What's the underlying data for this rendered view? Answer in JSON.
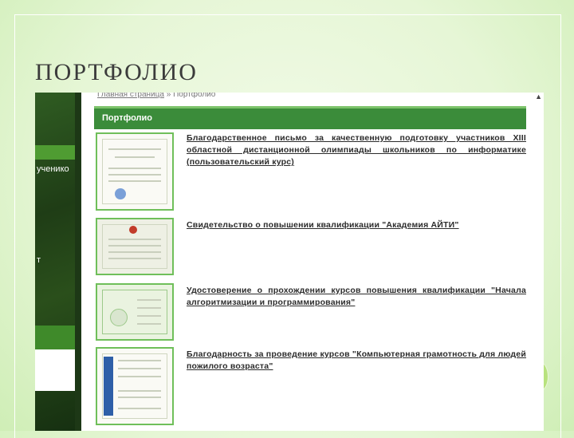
{
  "slide": {
    "title": "ПОРТФОЛИО"
  },
  "left_panel": {
    "text_1": "ученико",
    "text_2": "т"
  },
  "page": {
    "breadcrumb": {
      "home": "Главная страница",
      "separator": "»",
      "current": "Портфолио"
    },
    "header": "Портфолио",
    "items": [
      {
        "title": "Благодарственное письмо за качественную подготовку участников XIII областной дистанционной олимпиады школьников по информатике (пользовательский курс)"
      },
      {
        "title": "Свидетельство о повышении квалификации \"Академия АЙТИ\""
      },
      {
        "title": "Удостоверение о прохождении курсов повышения квалификации \"Начала алгоритмизации и программирования\""
      },
      {
        "title": "Благодарность за проведение курсов \"Компьютерная грамотность для людей пожилого возраста\""
      }
    ]
  },
  "colors": {
    "accent_green": "#3b8c3a",
    "slide_background": "#e6f6d6"
  }
}
